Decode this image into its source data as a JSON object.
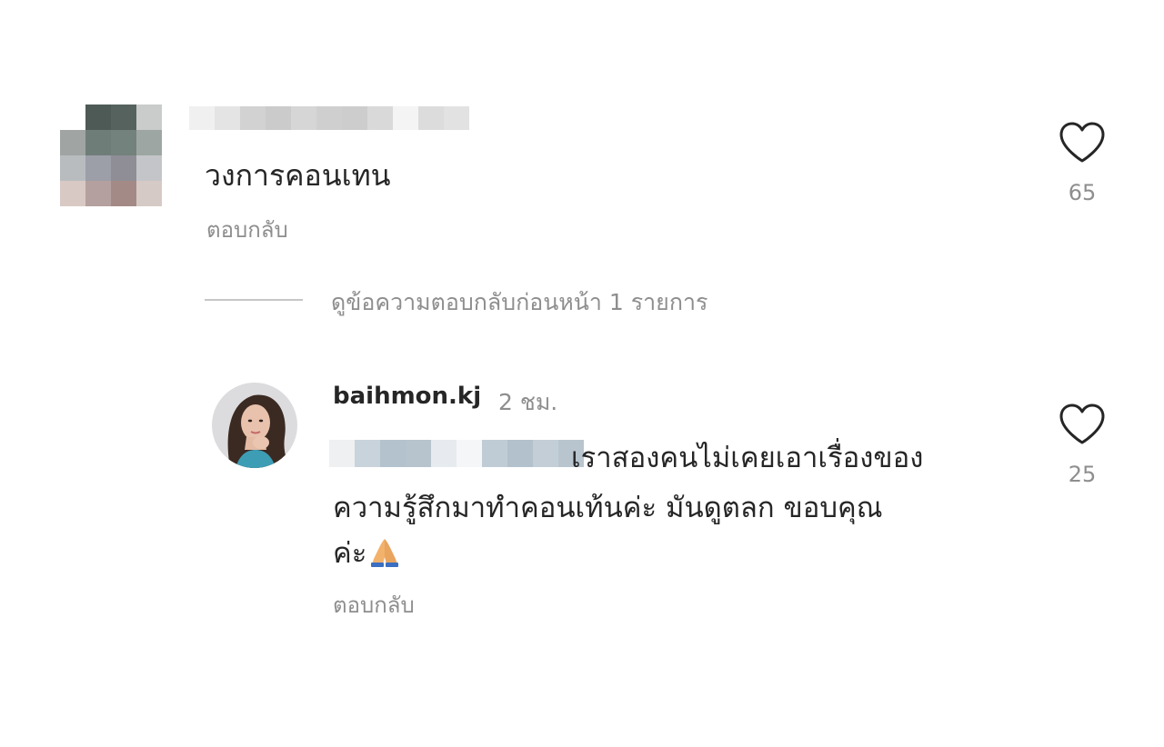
{
  "colors": {
    "text_primary": "#262626",
    "text_secondary": "#8e8e8e",
    "divider": "#c7c7c7",
    "background": "#ffffff"
  },
  "comment_1": {
    "avatar": "pixelated-avatar",
    "username_censored": true,
    "text": "วงการคอนเทน",
    "reply_label": "ตอบกลับ",
    "likes": "65",
    "like_icon": "heart-icon"
  },
  "thread": {
    "view_previous_label": "ดูข้อความตอบกลับก่อนหน้า 1 รายการ"
  },
  "comment_2": {
    "avatar": "profile-photo",
    "username": "baihmon.kj",
    "timestamp": "2 ชม.",
    "mention_censored": true,
    "text_line_1": "เราสองคนไม่เคยเอาเรื่องของ",
    "text_line_2": "ความรู้สึกมาทำคอนเท้นค่ะ มันดูตลก ขอบคุณ",
    "text_line_3": "ค่ะ",
    "emoji": "folded-hands-emoji",
    "reply_label": "ตอบกลับ",
    "likes": "25",
    "like_icon": "heart-icon"
  }
}
